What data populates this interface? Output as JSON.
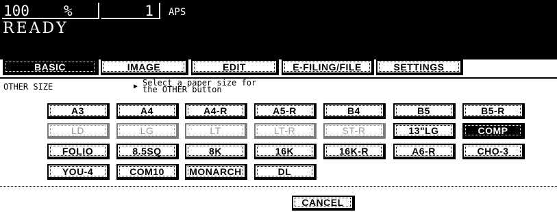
{
  "header": {
    "zoom_value": "100",
    "zoom_unit": "%",
    "copies": "1",
    "paper_mode": "APS",
    "status": "READY"
  },
  "tabs": [
    {
      "label": "BASIC",
      "active": true
    },
    {
      "label": "IMAGE",
      "active": false
    },
    {
      "label": "EDIT",
      "active": false
    },
    {
      "label": "E-FILING/FILE",
      "active": false
    },
    {
      "label": "SETTINGS",
      "active": false
    }
  ],
  "panel": {
    "title": "OTHER SIZE",
    "instruction": "Select a paper size for\nthe OTHER button"
  },
  "paper_sizes": {
    "row1": [
      "A3",
      "A4",
      "A4-R",
      "A5-R",
      "B4",
      "B5",
      "B5-R"
    ],
    "row2": [
      "LD",
      "LG",
      "LT",
      "LT-R",
      "ST-R",
      "13\"LG",
      "COMP"
    ],
    "row3": [
      "FOLIO",
      "8.5SQ",
      "8K",
      "16K",
      "16K-R",
      "A6-R",
      "CHO-3"
    ],
    "row4": [
      "YOU-4",
      "COM10",
      "MONARCH",
      "DL"
    ],
    "disabled": [
      "LD",
      "LG",
      "LT",
      "LT-R",
      "ST-R"
    ],
    "selected": "COMP"
  },
  "footer": {
    "cancel_label": "CANCEL"
  }
}
